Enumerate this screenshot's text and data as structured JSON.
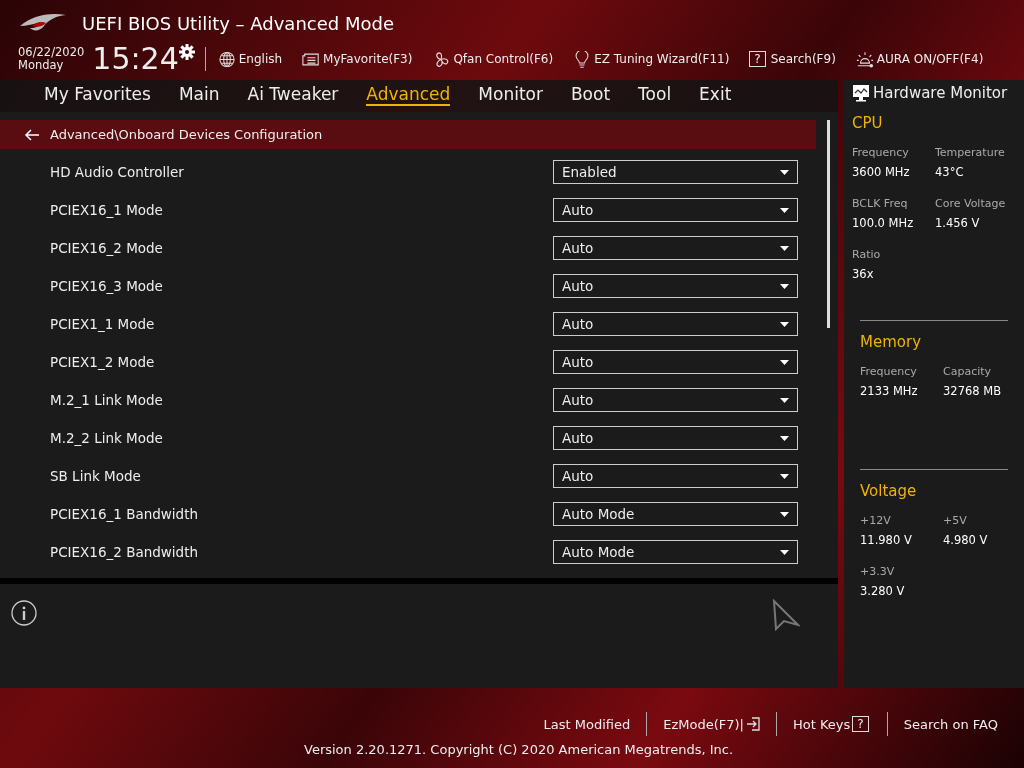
{
  "header": {
    "title": "UEFI BIOS Utility – Advanced Mode",
    "date": "06/22/2020",
    "day": "Monday",
    "time": "15:24",
    "tools": [
      {
        "kind": "globe",
        "label": "English"
      },
      {
        "kind": "favorite",
        "label": "MyFavorite(F3)"
      },
      {
        "kind": "fan",
        "label": "Qfan Control(F6)"
      },
      {
        "kind": "bulb",
        "label": "EZ Tuning Wizard(F11)"
      },
      {
        "kind": "help",
        "icon_text": "?",
        "label": "Search(F9)"
      },
      {
        "kind": "aura",
        "label": "AURA ON/OFF(F4)"
      }
    ]
  },
  "tabs": [
    {
      "label": "My Favorites",
      "selected": false
    },
    {
      "label": "Main",
      "selected": false
    },
    {
      "label": "Ai Tweaker",
      "selected": false
    },
    {
      "label": "Advanced",
      "selected": true
    },
    {
      "label": "Monitor",
      "selected": false
    },
    {
      "label": "Boot",
      "selected": false
    },
    {
      "label": "Tool",
      "selected": false
    },
    {
      "label": "Exit",
      "selected": false
    }
  ],
  "breadcrumb": "Advanced\\Onboard Devices Configuration",
  "settings": [
    {
      "label": "HD Audio Controller",
      "value": "Enabled"
    },
    {
      "label": "PCIEX16_1 Mode",
      "value": "Auto"
    },
    {
      "label": "PCIEX16_2 Mode",
      "value": "Auto"
    },
    {
      "label": "PCIEX16_3 Mode",
      "value": "Auto"
    },
    {
      "label": "PCIEX1_1 Mode",
      "value": "Auto"
    },
    {
      "label": "PCIEX1_2 Mode",
      "value": "Auto"
    },
    {
      "label": "M.2_1 Link Mode",
      "value": "Auto"
    },
    {
      "label": "M.2_2 Link Mode",
      "value": "Auto"
    },
    {
      "label": "SB Link Mode",
      "value": "Auto"
    },
    {
      "label": "PCIEX16_1 Bandwidth",
      "value": "Auto Mode"
    },
    {
      "label": "PCIEX16_2 Bandwidth",
      "value": "Auto Mode"
    }
  ],
  "hardware_monitor": {
    "title": "Hardware Monitor",
    "sections": [
      {
        "title": "CPU",
        "items": [
          {
            "label": "Frequency",
            "value": "3600 MHz"
          },
          {
            "label": "Temperature",
            "value": "43°C"
          },
          {
            "label": "BCLK Freq",
            "value": "100.0 MHz"
          },
          {
            "label": "Core Voltage",
            "value": "1.456 V"
          },
          {
            "label": "Ratio",
            "value": "36x"
          }
        ]
      },
      {
        "title": "Memory",
        "items": [
          {
            "label": "Frequency",
            "value": "2133 MHz"
          },
          {
            "label": "Capacity",
            "value": "32768 MB"
          }
        ]
      },
      {
        "title": "Voltage",
        "items": [
          {
            "label": "+12V",
            "value": "11.980 V"
          },
          {
            "label": "+5V",
            "value": "4.980 V"
          },
          {
            "label": "+3.3V",
            "value": "3.280 V"
          }
        ]
      }
    ]
  },
  "footer": {
    "links": [
      {
        "kind": "text",
        "label": "Last Modified"
      },
      {
        "kind": "ezmode",
        "label": "EzMode(F7)|"
      },
      {
        "kind": "hotkeys",
        "label": "Hot Keys",
        "icon_text": "?"
      },
      {
        "kind": "text",
        "label": "Search on FAQ"
      }
    ],
    "version": "Version 2.20.1271. Copyright (C) 2020 American Megatrends, Inc."
  }
}
